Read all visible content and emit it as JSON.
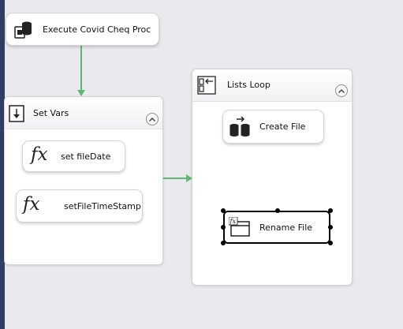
{
  "tasks": {
    "execute_proc": "Execute Covid Cheq Proc",
    "set_file_date": "set fileDate",
    "set_file_timestamp": "setFileTimeStamp",
    "create_file": "Create File",
    "rename_file": "Rename File"
  },
  "containers": {
    "set_vars": "Set Vars",
    "lists_loop": "Lists Loop"
  },
  "icons": {
    "execute_proc": "sql-task-icon",
    "expression": "fx",
    "set_vars": "sequence-container-icon",
    "lists_loop": "foreach-loop-icon",
    "create_file": "file-system-task-icon",
    "rename_file": "file-system-task-icon"
  },
  "colors": {
    "connector": "#5db974",
    "sidebar": "#2f3e62",
    "canvas": "#eaeaee"
  }
}
